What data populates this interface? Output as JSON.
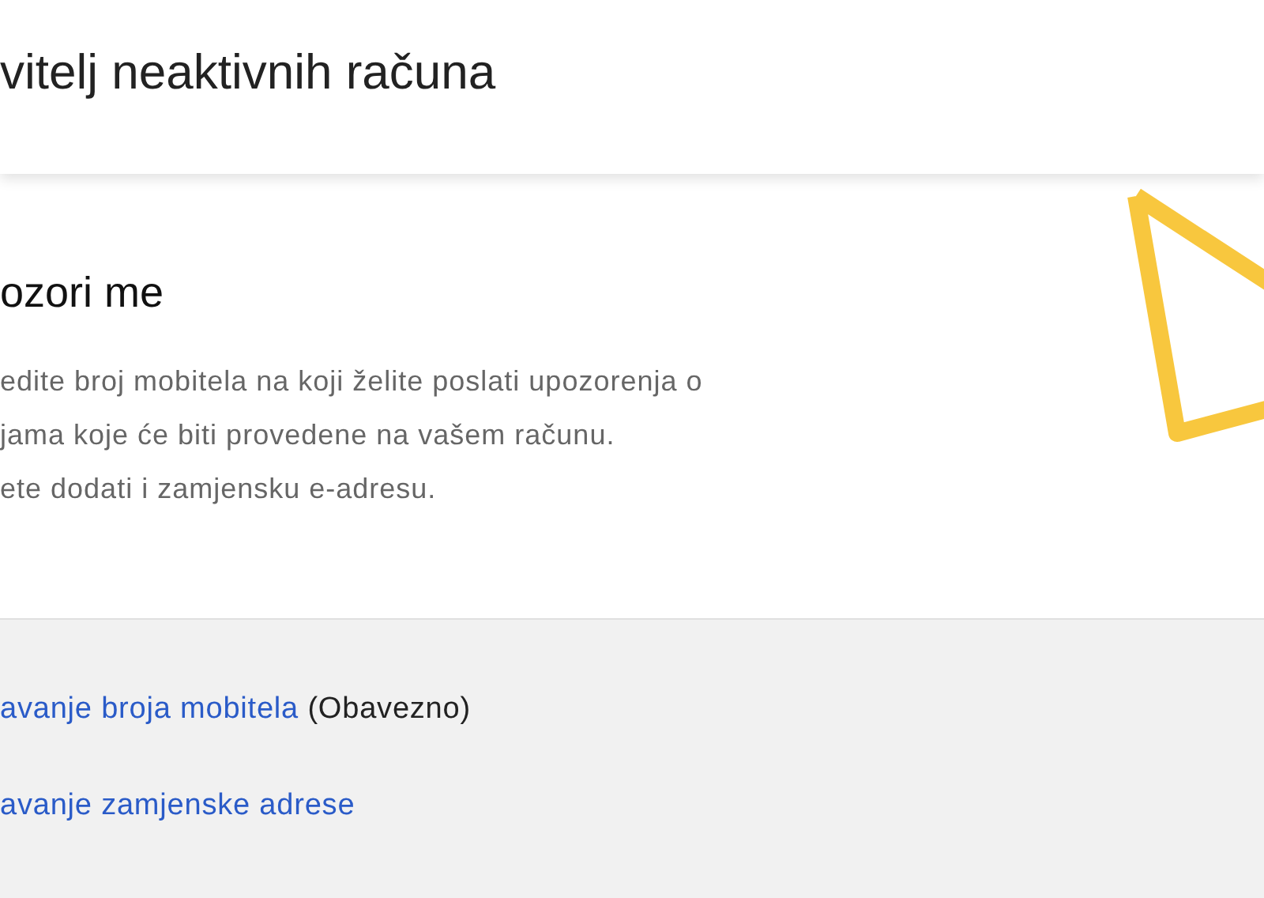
{
  "header": {
    "title": "vitelj neaktivnih računa"
  },
  "alert_section": {
    "heading": "ozori me",
    "lines": [
      "edite broj mobitela na koji želite poslati upozorenja o",
      "jama koje će biti provedene na vašem računu.",
      "ete dodati i zamjensku e-adresu."
    ]
  },
  "links": [
    {
      "label": "avanje broja mobitela",
      "note": "(Obavezno)"
    },
    {
      "label": "avanje zamjenske adrese"
    }
  ]
}
